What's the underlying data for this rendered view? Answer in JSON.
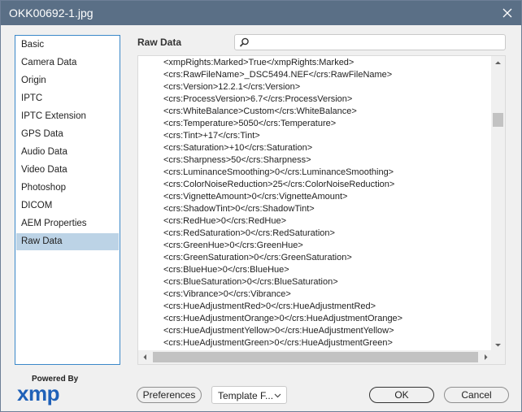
{
  "window": {
    "title": "OKK00692-1.jpg"
  },
  "sidebar": {
    "selected_index": 11,
    "items": [
      {
        "label": "Basic"
      },
      {
        "label": "Camera Data"
      },
      {
        "label": "Origin"
      },
      {
        "label": "IPTC"
      },
      {
        "label": "IPTC Extension"
      },
      {
        "label": "GPS Data"
      },
      {
        "label": "Audio Data"
      },
      {
        "label": "Video Data"
      },
      {
        "label": "Photoshop"
      },
      {
        "label": "DICOM"
      },
      {
        "label": "AEM Properties"
      },
      {
        "label": "Raw Data"
      }
    ]
  },
  "main": {
    "section_label": "Raw Data",
    "search": {
      "value": "",
      "placeholder": ""
    },
    "lines": [
      "<xmpRights:Marked>True</xmpRights:Marked>",
      "<crs:RawFileName>_DSC5494.NEF</crs:RawFileName>",
      "<crs:Version>12.2.1</crs:Version>",
      "<crs:ProcessVersion>6.7</crs:ProcessVersion>",
      "<crs:WhiteBalance>Custom</crs:WhiteBalance>",
      "<crs:Temperature>5050</crs:Temperature>",
      "<crs:Tint>+17</crs:Tint>",
      "<crs:Saturation>+10</crs:Saturation>",
      "<crs:Sharpness>50</crs:Sharpness>",
      "<crs:LuminanceSmoothing>0</crs:LuminanceSmoothing>",
      "<crs:ColorNoiseReduction>25</crs:ColorNoiseReduction>",
      "<crs:VignetteAmount>0</crs:VignetteAmount>",
      "<crs:ShadowTint>0</crs:ShadowTint>",
      "<crs:RedHue>0</crs:RedHue>",
      "<crs:RedSaturation>0</crs:RedSaturation>",
      "<crs:GreenHue>0</crs:GreenHue>",
      "<crs:GreenSaturation>0</crs:GreenSaturation>",
      "<crs:BlueHue>0</crs:BlueHue>",
      "<crs:BlueSaturation>0</crs:BlueSaturation>",
      "<crs:Vibrance>0</crs:Vibrance>",
      "<crs:HueAdjustmentRed>0</crs:HueAdjustmentRed>",
      "<crs:HueAdjustmentOrange>0</crs:HueAdjustmentOrange>",
      "<crs:HueAdjustmentYellow>0</crs:HueAdjustmentYellow>",
      "<crs:HueAdjustmentGreen>0</crs:HueAdjustmentGreen>"
    ]
  },
  "footer": {
    "logo_powered": "Powered By",
    "logo_text": "xmp",
    "preferences_label": "Preferences",
    "template_label": "Template F...",
    "ok_label": "OK",
    "cancel_label": "Cancel"
  },
  "colors": {
    "titlebar": "#5a6f86",
    "selected_item": "#bcd3e6",
    "sidebar_border": "#3b88c9",
    "xmp_logo": "#1f61b8"
  },
  "icons": [
    "close-icon",
    "search-icon",
    "scroll-up-icon",
    "scroll-down-icon",
    "scroll-left-icon",
    "scroll-right-icon",
    "chevron-down-icon"
  ]
}
